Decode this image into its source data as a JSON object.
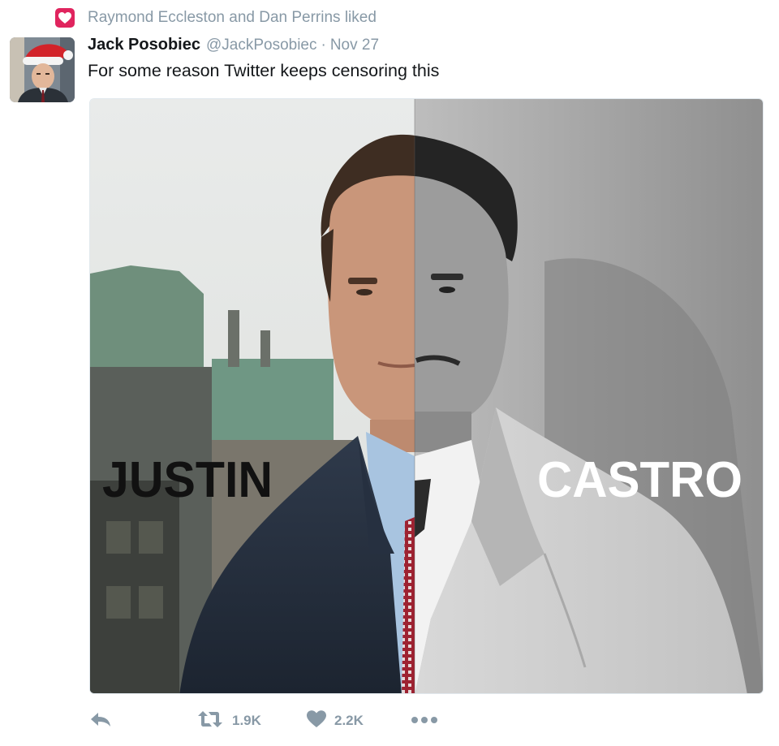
{
  "social_context": {
    "text": "Raymond Eccleston and Dan Perrins liked",
    "icon": "heart-icon",
    "accent": "#e0245e"
  },
  "tweet": {
    "author_name": "Jack Posobiec",
    "author_handle": "@JackPosobiec",
    "separator": "·",
    "timestamp": "Nov 27",
    "text": "For some reason Twitter keeps censoring this",
    "media": {
      "left_label": "JUSTIN",
      "right_label": "CASTRO"
    },
    "actions": {
      "reply": {
        "icon": "reply-icon"
      },
      "retweet": {
        "icon": "retweet-icon",
        "count": "1.9K"
      },
      "like": {
        "icon": "heart-icon",
        "count": "2.2K"
      },
      "more": {
        "icon": "more-icon"
      }
    }
  },
  "colors": {
    "text_primary": "#14171a",
    "text_secondary": "#8899a6",
    "like_badge": "#e0245e"
  }
}
